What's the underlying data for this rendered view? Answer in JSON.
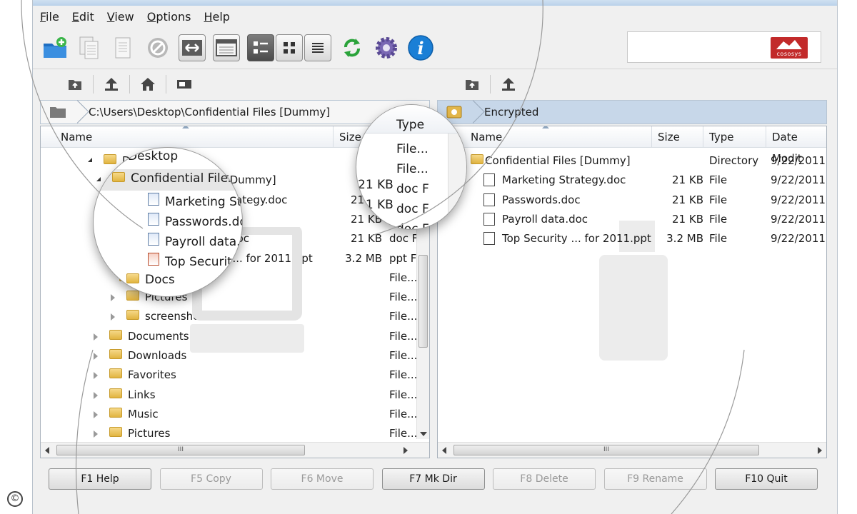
{
  "menu": [
    {
      "label": "File",
      "hotkey": "F",
      "rest": "ile"
    },
    {
      "label": "Edit",
      "hotkey": "E",
      "rest": "dit"
    },
    {
      "label": "View",
      "hotkey": "V",
      "rest": "iew"
    },
    {
      "label": "Options",
      "hotkey": "O",
      "rest": "ptions"
    },
    {
      "label": "Help",
      "hotkey": "H",
      "rest": "elp"
    }
  ],
  "brand": {
    "logo_text": "cososys"
  },
  "left_pane": {
    "path": "C:\\Users\\Desktop\\Confidential Files [Dummy]",
    "columns": {
      "name": "Name",
      "size": "Size",
      "type": "Type"
    },
    "rows": [
      {
        "name": "Desktop",
        "size": "",
        "type": "File..."
      },
      {
        "name": "Confidential Files [Dummy]",
        "size": "",
        "type": "File..."
      },
      {
        "name": "Marketing Strategy.doc",
        "size": "21 KB",
        "type": "doc F"
      },
      {
        "name": "Passwords.doc",
        "size": "21 KB",
        "type": "doc F"
      },
      {
        "name": "Payroll data.doc",
        "size": "21 KB",
        "type": "doc F"
      },
      {
        "name": "Top Security ... for 2011.ppt",
        "size": "3.2 MB",
        "type": "ppt F"
      },
      {
        "name": "Docs",
        "size": "",
        "type": "File..."
      },
      {
        "name": "Pictures",
        "size": "",
        "type": "File..."
      },
      {
        "name": "screenshots",
        "size": "",
        "type": "File..."
      },
      {
        "name": "Documents",
        "size": "",
        "type": "File..."
      },
      {
        "name": "Downloads",
        "size": "",
        "type": "File..."
      },
      {
        "name": "Favorites",
        "size": "",
        "type": "File..."
      },
      {
        "name": "Links",
        "size": "",
        "type": "File..."
      },
      {
        "name": "Music",
        "size": "",
        "type": "File..."
      },
      {
        "name": "Pictures",
        "size": "",
        "type": "File..."
      }
    ]
  },
  "right_pane": {
    "path": "Encrypted",
    "columns": {
      "name": "Name",
      "size": "Size",
      "type": "Type",
      "date": "Date Modit"
    },
    "rows": [
      {
        "name": "Confidential Files [Dummy]",
        "size": "",
        "type": "Directory",
        "date": "9/22/2011 2"
      },
      {
        "name": "Marketing Strategy.doc",
        "size": "21 KB",
        "type": "File",
        "date": "9/22/2011 2"
      },
      {
        "name": "Passwords.doc",
        "size": "21 KB",
        "type": "File",
        "date": "9/22/2011 2"
      },
      {
        "name": "Payroll data.doc",
        "size": "21 KB",
        "type": "File",
        "date": "9/22/2011 2"
      },
      {
        "name": "Top Security ... for 2011.ppt",
        "size": "3.2 MB",
        "type": "File",
        "date": "9/22/2011 2"
      }
    ]
  },
  "scroll_grip": "III",
  "magnifier_left": {
    "lines": [
      "Desktop",
      "Confidential Files [Dummy]",
      "Marketing Strategy.doc",
      "Passwords.doc",
      "Payroll data.doc",
      "Top Security ... for 2011.ppt",
      "Docs"
    ]
  },
  "magnifier_right": {
    "header": "Type",
    "lines": [
      "File...",
      "File...",
      "doc F",
      "doc F",
      "doc F"
    ],
    "sizes": [
      "21 KB",
      "21 KB"
    ]
  },
  "function_keys": [
    {
      "label": "F1 Help",
      "enabled": true
    },
    {
      "label": "F5 Copy",
      "enabled": false
    },
    {
      "label": "F6 Move",
      "enabled": false
    },
    {
      "label": "F7 Mk Dir",
      "enabled": true
    },
    {
      "label": "F8 Delete",
      "enabled": false
    },
    {
      "label": "F9 Rename",
      "enabled": false
    },
    {
      "label": "F10 Quit",
      "enabled": true
    }
  ],
  "copyright_symbol": "©",
  "colors": {
    "accent_blue": "#1a7fd6",
    "brand_red": "#c22a2a",
    "encrypted_bar": "#c7d7e9"
  },
  "icons": {
    "toolbar": [
      "new-folder-icon",
      "copy-icon",
      "paste-icon",
      "cancel-icon",
      "swap-panes-icon",
      "window-icon",
      "details-view-icon",
      "icons-view-icon",
      "list-view-icon",
      "refresh-icon",
      "settings-gear-icon",
      "info-icon"
    ],
    "nav": [
      "up-folder-icon",
      "root-icon",
      "home-icon",
      "drive-icon"
    ]
  }
}
